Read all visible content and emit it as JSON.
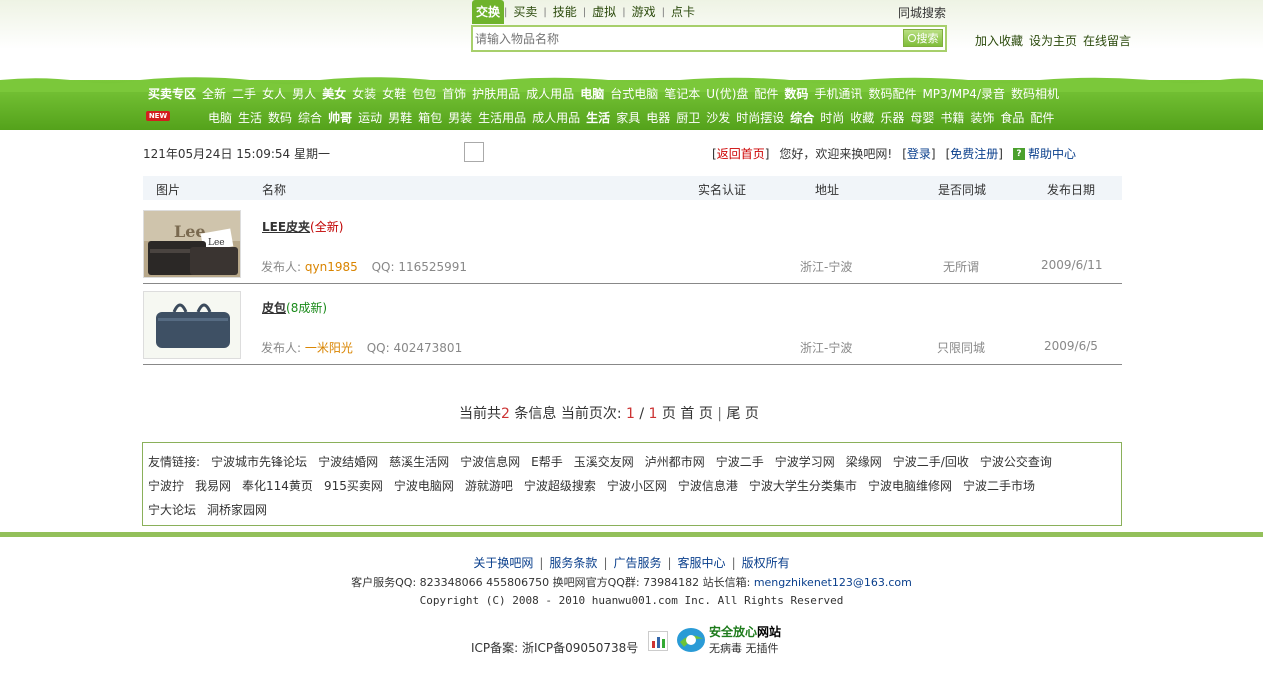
{
  "search": {
    "tabs": [
      "交换",
      "买卖",
      "技能",
      "虚拟",
      "游戏",
      "点卡"
    ],
    "city_search": "同城搜索",
    "placeholder": "请输入物品名称",
    "button": "搜索"
  },
  "top_links": [
    "加入收藏",
    "设为主页",
    "在线留言"
  ],
  "nav": {
    "badge": "NEW",
    "row1": [
      {
        "cat": "买卖专区",
        "items": [
          "全新",
          "二手",
          "女人",
          "男人"
        ]
      },
      {
        "cat": "美女",
        "items": [
          "女装",
          "女鞋",
          "包包",
          "首饰",
          "护肤用品",
          "成人用品"
        ]
      },
      {
        "cat": "电脑",
        "items": [
          "台式电脑",
          "笔记本",
          "U(优)盘",
          "配件"
        ]
      },
      {
        "cat": "数码",
        "items": [
          "手机通讯",
          "数码配件",
          "MP3/MP4/录音",
          "数码相机"
        ]
      }
    ],
    "row2": [
      {
        "cat": "",
        "items": [
          "电脑",
          "生活",
          "数码",
          "综合"
        ]
      },
      {
        "cat": "帅哥",
        "items": [
          "运动",
          "男鞋",
          "箱包",
          "男装",
          "生活用品",
          "成人用品"
        ]
      },
      {
        "cat": "生活",
        "items": [
          "家具",
          "电器",
          "厨卫",
          "沙发",
          "时尚摆设"
        ]
      },
      {
        "cat": "综合",
        "items": [
          "时尚",
          "收藏",
          "乐器",
          "母婴",
          "书籍",
          "装饰",
          "食品",
          "配件"
        ]
      }
    ]
  },
  "info": {
    "datetime": "121年05月24日 15:09:54 星期一",
    "back_home": "返回首页",
    "welcome": "您好，欢迎来换吧网!",
    "login": "登录",
    "register": "免费注册",
    "help": "帮助中心"
  },
  "table": {
    "headers": [
      "图片",
      "名称",
      "实名认证",
      "地址",
      "是否同城",
      "发布日期"
    ],
    "rows": [
      {
        "name": "LEE皮夹",
        "condition": "(全新)",
        "condition_color": "#c00000",
        "publisher_label": "发布人:",
        "publisher": "qyn1985",
        "qq_label": "QQ:",
        "qq": "116525991",
        "address": "浙江-宁波",
        "same_city": "无所谓",
        "date": "2009/6/11"
      },
      {
        "name": "皮包",
        "condition": "(8成新)",
        "condition_color": "#1a8a1a",
        "publisher_label": "发布人:",
        "publisher": "一米阳光",
        "qq_label": "QQ:",
        "qq": "402473801",
        "address": "浙江-宁波",
        "same_city": "只限同城",
        "date": "2009/6/5"
      }
    ]
  },
  "pager": {
    "prefix": "当前共",
    "total": "2",
    "suffix": "条信息  当前页次:",
    "current": "1",
    "slash": "/",
    "pages": "1",
    "page_label": "页",
    "first": "首 页",
    "last": "尾 页"
  },
  "friend_links": {
    "label": "友情链接:",
    "links": [
      "宁波城市先锋论坛",
      "宁波结婚网",
      "慈溪生活网",
      "宁波信息网",
      "E帮手",
      "玉溪交友网",
      "泸州都市网",
      "宁波二手",
      "宁波学习网",
      "梁缘网",
      "宁波二手/回收",
      "宁波公交查询",
      "宁波拧",
      "我易网",
      "奉化114黄页",
      "915买卖网",
      "宁波电脑网",
      "游就游吧",
      "宁波超级搜索",
      "宁波小区网",
      "宁波信息港",
      "宁波大学生分类集市",
      "宁波电脑维修网",
      "宁波二手市场",
      "宁大论坛",
      "洞桥家园网"
    ]
  },
  "footer": {
    "nav": [
      "关于换吧网",
      "服务条款",
      "广告服务",
      "客服中心",
      "版权所有"
    ],
    "contact": "客户服务QQ: 823348066 455806750 换吧网官方QQ群: 73984182 站长信箱:",
    "email": "mengzhikenet123@163.com",
    "copyright": "Copyright (C) 2008 - 2010 huanwu001.com Inc. All Rights Reserved",
    "icp": "ICP备案: 浙ICP备09050738号",
    "safe_title_a": "安全放心",
    "safe_title_b": "网站",
    "safe_sub": "无病毒 无插件"
  },
  "colors": {
    "nav_green": "#5aab22",
    "link_blue": "#0a3f8c",
    "accent_red": "#c00000"
  }
}
